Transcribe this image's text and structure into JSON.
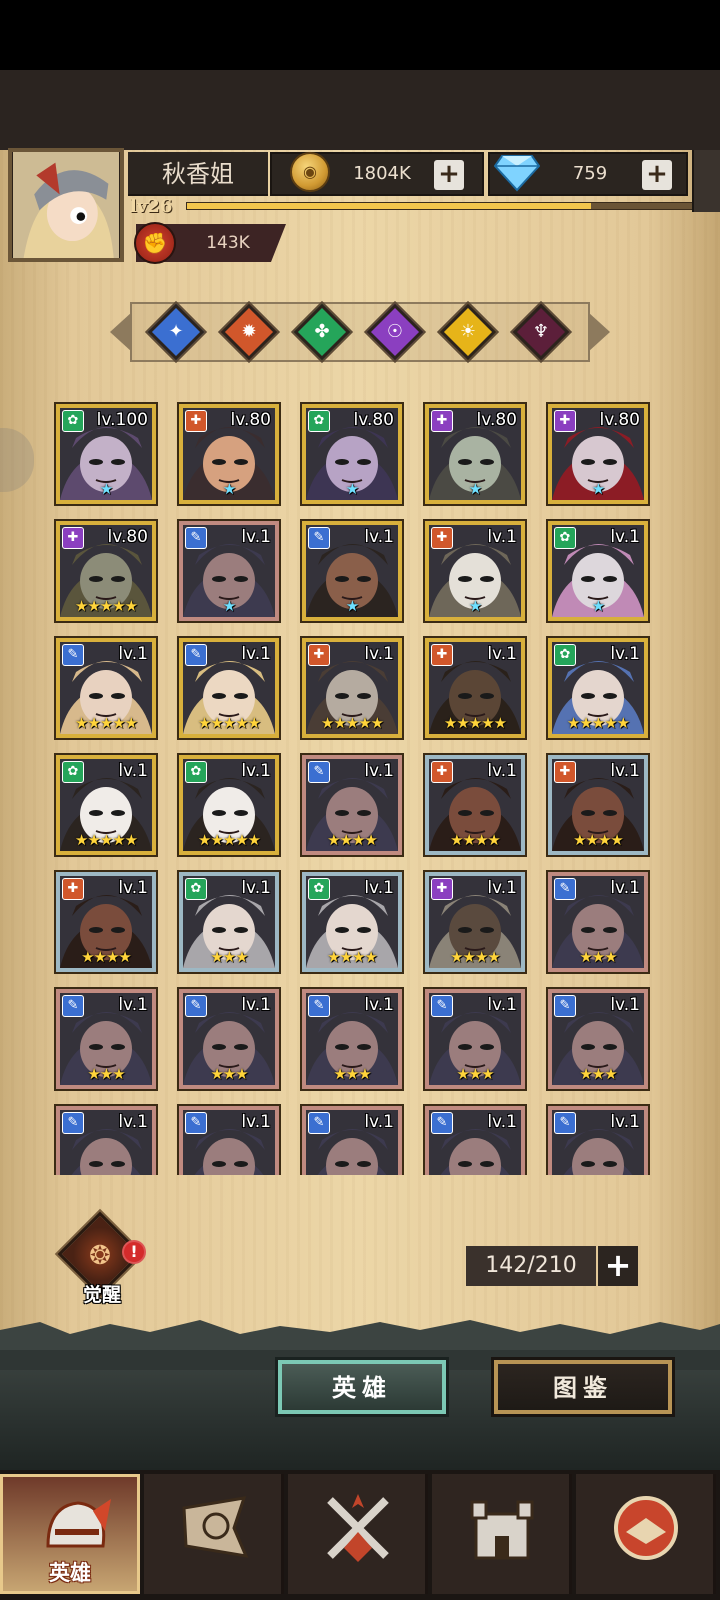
{
  "player": {
    "name": "秋香姐",
    "level": "lv26",
    "xp_fraction": 0.78,
    "power": "143K"
  },
  "currencies": {
    "gold": "1804K",
    "gems": "759"
  },
  "faction_filters": [
    {
      "name": "water",
      "color": "#3b6fd1",
      "glyph": "✦"
    },
    {
      "name": "fire",
      "color": "#d1572b",
      "glyph": "✹"
    },
    {
      "name": "nature",
      "color": "#25a55a",
      "glyph": "✤"
    },
    {
      "name": "shadow",
      "color": "#8b3fc0",
      "glyph": "☉"
    },
    {
      "name": "light",
      "color": "#e6b419",
      "glyph": "☀"
    },
    {
      "name": "dark",
      "color": "#5c1f3a",
      "glyph": "♆"
    }
  ],
  "heroes": [
    {
      "level": "lv.100",
      "faction": "nature",
      "stars": "★",
      "frame": "gold",
      "skin": "#c3b1c8",
      "hair": "#5d4a6e"
    },
    {
      "level": "lv.80",
      "faction": "fire",
      "stars": "★",
      "frame": "gold",
      "skin": "#d6a17f",
      "hair": "#3a2d2f"
    },
    {
      "level": "lv.80",
      "faction": "nature",
      "stars": "★",
      "frame": "gold",
      "skin": "#b7a3c5",
      "hair": "#3d3553"
    },
    {
      "level": "lv.80",
      "faction": "shadow",
      "stars": "★",
      "frame": "gold",
      "skin": "#a9b3a2",
      "hair": "#4b4a44"
    },
    {
      "level": "lv.80",
      "faction": "shadow",
      "stars": "★",
      "frame": "gold",
      "skin": "#d7c8d0",
      "hair": "#8c1c25"
    },
    {
      "level": "lv.80",
      "faction": "shadow",
      "stars": "★★★★★",
      "frame": "gold",
      "skin": "#8c8c78",
      "hair": "#5a553c"
    },
    {
      "level": "lv.1",
      "faction": "water",
      "stars": "★",
      "frame": "rose",
      "skin": "#9b7d7d",
      "hair": "#3d3a4f"
    },
    {
      "level": "lv.1",
      "faction": "water",
      "stars": "★",
      "frame": "gold",
      "skin": "#8a5f4a",
      "hair": "#2b2420"
    },
    {
      "level": "lv.1",
      "faction": "fire",
      "stars": "★",
      "frame": "gold",
      "skin": "#e4e0d8",
      "hair": "#6e6759"
    },
    {
      "level": "lv.1",
      "faction": "nature",
      "stars": "★",
      "frame": "gold",
      "skin": "#ddd7dc",
      "hair": "#c08ab6"
    },
    {
      "level": "lv.1",
      "faction": "water",
      "stars": "★★★★★",
      "frame": "gold",
      "skin": "#e8d2c0",
      "hair": "#d7b98c"
    },
    {
      "level": "lv.1",
      "faction": "water",
      "stars": "★★★★★",
      "frame": "gold",
      "skin": "#ecd8c2",
      "hair": "#d8bd80"
    },
    {
      "level": "lv.1",
      "faction": "fire",
      "stars": "★★★★★",
      "frame": "gold",
      "skin": "#b5aba0",
      "hair": "#4a3d35"
    },
    {
      "level": "lv.1",
      "faction": "fire",
      "stars": "★★★★★",
      "frame": "gold",
      "skin": "#5b4636",
      "hair": "#2a211a"
    },
    {
      "level": "lv.1",
      "faction": "nature",
      "stars": "★★★★★",
      "frame": "gold",
      "skin": "#e4d6ce",
      "hair": "#5572b2"
    },
    {
      "level": "lv.1",
      "faction": "nature",
      "stars": "★★★★★",
      "frame": "gold",
      "skin": "#f0ece8",
      "hair": "#2b2420"
    },
    {
      "level": "lv.1",
      "faction": "nature",
      "stars": "★★★★★",
      "frame": "gold",
      "skin": "#f0ece8",
      "hair": "#2b2420"
    },
    {
      "level": "lv.1",
      "faction": "water",
      "stars": "★★★★",
      "frame": "rose",
      "skin": "#9b7d7d",
      "hair": "#3d3a4f"
    },
    {
      "level": "lv.1",
      "faction": "fire",
      "stars": "★★★★",
      "frame": "blue",
      "skin": "#7a4c3c",
      "hair": "#2a1d18"
    },
    {
      "level": "lv.1",
      "faction": "fire",
      "stars": "★★★★",
      "frame": "blue",
      "skin": "#7a4c3c",
      "hair": "#2a1d18"
    },
    {
      "level": "lv.1",
      "faction": "fire",
      "stars": "★★★★",
      "frame": "blue",
      "skin": "#7a4c3c",
      "hair": "#2a1d18"
    },
    {
      "level": "lv.1",
      "faction": "nature",
      "stars": "★★★",
      "frame": "blue",
      "skin": "#e4d7cf",
      "hair": "#a8a6aa"
    },
    {
      "level": "lv.1",
      "faction": "nature",
      "stars": "★★★★",
      "frame": "blue",
      "skin": "#e4d7cf",
      "hair": "#a8a6aa"
    },
    {
      "level": "lv.1",
      "faction": "shadow",
      "stars": "★★★★",
      "frame": "blue",
      "skin": "#5a4a3e",
      "hair": "#8a8377"
    },
    {
      "level": "lv.1",
      "faction": "water",
      "stars": "★★★",
      "frame": "rose",
      "skin": "#9b7d7d",
      "hair": "#3d3a4f"
    },
    {
      "level": "lv.1",
      "faction": "water",
      "stars": "★★★",
      "frame": "rose",
      "skin": "#9b7d7d",
      "hair": "#3d3a4f"
    },
    {
      "level": "lv.1",
      "faction": "water",
      "stars": "★★★",
      "frame": "rose",
      "skin": "#9b7d7d",
      "hair": "#3d3a4f"
    },
    {
      "level": "lv.1",
      "faction": "water",
      "stars": "★★★",
      "frame": "rose",
      "skin": "#9b7d7d",
      "hair": "#3d3a4f"
    },
    {
      "level": "lv.1",
      "faction": "water",
      "stars": "★★★",
      "frame": "rose",
      "skin": "#9b7d7d",
      "hair": "#3d3a4f"
    },
    {
      "level": "lv.1",
      "faction": "water",
      "stars": "★★★",
      "frame": "rose",
      "skin": "#9b7d7d",
      "hair": "#3d3a4f"
    },
    {
      "level": "lv.1",
      "faction": "water",
      "stars": "",
      "frame": "rose",
      "skin": "#9b7d7d",
      "hair": "#3d3a4f"
    },
    {
      "level": "lv.1",
      "faction": "water",
      "stars": "",
      "frame": "rose",
      "skin": "#9b7d7d",
      "hair": "#3d3a4f"
    },
    {
      "level": "lv.1",
      "faction": "water",
      "stars": "",
      "frame": "rose",
      "skin": "#9b7d7d",
      "hair": "#3d3a4f"
    },
    {
      "level": "lv.1",
      "faction": "water",
      "stars": "",
      "frame": "rose",
      "skin": "#9b7d7d",
      "hair": "#3d3a4f"
    },
    {
      "level": "lv.1",
      "faction": "water",
      "stars": "",
      "frame": "rose",
      "skin": "#9b7d7d",
      "hair": "#3d3a4f"
    }
  ],
  "awaken": {
    "label": "觉醒",
    "alert": "!"
  },
  "capacity": "142/210",
  "tabs": {
    "heroes": "英雄",
    "codex": "图鉴"
  },
  "bottom_nav": [
    {
      "name": "heroes",
      "label": "英雄",
      "icon": "helmet-icon"
    },
    {
      "name": "adventure",
      "label": "",
      "icon": "flag-icon"
    },
    {
      "name": "battle",
      "label": "",
      "icon": "crossed-swords-icon"
    },
    {
      "name": "castle",
      "label": "",
      "icon": "castle-icon"
    },
    {
      "name": "guild",
      "label": "",
      "icon": "handshake-icon"
    }
  ]
}
